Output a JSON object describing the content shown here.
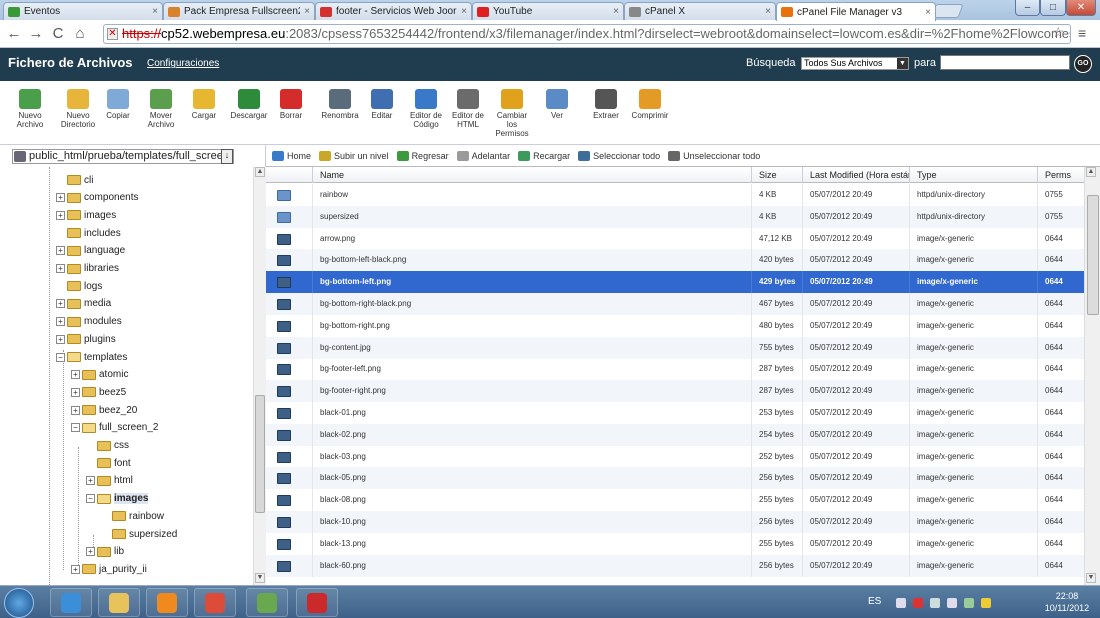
{
  "browser": {
    "tabs": [
      {
        "label": "Eventos",
        "icon": "green-calendar-icon",
        "color": "#3a9a3a"
      },
      {
        "label": "Pack Empresa Fullscreen2",
        "icon": "joomla-icon",
        "color": "#d9822b"
      },
      {
        "label": "footer - Servicios Web Joor",
        "icon": "w-icon",
        "color": "#d43030"
      },
      {
        "label": "YouTube",
        "icon": "youtube-icon",
        "color": "#e02020"
      },
      {
        "label": "cPanel X",
        "icon": "loading-icon",
        "color": "#888888"
      },
      {
        "label": "cPanel File Manager v3",
        "icon": "cpanel-icon",
        "color": "#e8730c"
      }
    ],
    "close_glyph": "×",
    "url": {
      "scheme": "https://",
      "host": "cp52.webempresa.eu",
      "rest": ":2083/cpsess7653254442/frontend/x3/filemanager/index.html?dirselect=webroot&domainselect=lowcom.es&dir=%2Fhome%2Flowcomes%2Fpub"
    },
    "nav": {
      "back": "←",
      "forward": "→",
      "reload": "C",
      "home": "⌂"
    },
    "star": "☆",
    "menu": "≡",
    "window_buttons": [
      "–",
      "□",
      "✕"
    ]
  },
  "header": {
    "title": "Fichero de Archivos",
    "config_link": "Configuraciones",
    "search_label": "Búsqueda",
    "search_scope": "Todos Sus Archivos",
    "search_for": "para",
    "search_value": "",
    "go": "GO"
  },
  "icon_toolbar": [
    {
      "label": "Nuevo\nArchivo",
      "icon": "new-file-icon",
      "color": "#4aa04a"
    },
    {
      "label": "Nuevo\nDirectorio",
      "icon": "new-folder-icon",
      "color": "#e6b53a"
    },
    {
      "label": "Copiar",
      "icon": "copy-icon",
      "color": "#7fa9d6"
    },
    {
      "label": "Mover\nArchivo",
      "icon": "move-file-icon",
      "color": "#5b9e4d"
    },
    {
      "label": "Cargar",
      "icon": "upload-icon",
      "color": "#e8b732"
    },
    {
      "label": "Descargar",
      "icon": "download-icon",
      "color": "#2e8b3c"
    },
    {
      "label": "Borrar",
      "icon": "delete-icon",
      "color": "#d42b2b"
    },
    {
      "label": "Renombra",
      "icon": "rename-icon",
      "color": "#5a6b7b"
    },
    {
      "label": "Editar",
      "icon": "edit-icon",
      "color": "#3f6fb0"
    },
    {
      "label": "Editor de\nCódigo",
      "icon": "code-editor-icon",
      "color": "#3a79c7"
    },
    {
      "label": "Editor de\nHTML",
      "icon": "html-editor-icon",
      "color": "#6b6b6b"
    },
    {
      "label": "Cambiar\nlos\nPermisos",
      "icon": "key-icon",
      "color": "#e0a21b"
    },
    {
      "label": "Ver",
      "icon": "view-icon",
      "color": "#5a8bc7"
    },
    {
      "label": "Extraer",
      "icon": "extract-icon",
      "color": "#555555"
    },
    {
      "label": "Comprimir",
      "icon": "compress-icon",
      "color": "#e39b25"
    }
  ],
  "sidebar": {
    "path": "public_html/prueba/templates/full_scree",
    "path_button": "↓",
    "tree": [
      {
        "label": "cli",
        "depth": 0,
        "expander": "",
        "open": false,
        "selected": false
      },
      {
        "label": "components",
        "depth": 0,
        "expander": "+",
        "open": false,
        "selected": false
      },
      {
        "label": "images",
        "depth": 0,
        "expander": "+",
        "open": false,
        "selected": false
      },
      {
        "label": "includes",
        "depth": 0,
        "expander": "",
        "open": false,
        "selected": false
      },
      {
        "label": "language",
        "depth": 0,
        "expander": "+",
        "open": false,
        "selected": false
      },
      {
        "label": "libraries",
        "depth": 0,
        "expander": "+",
        "open": false,
        "selected": false
      },
      {
        "label": "logs",
        "depth": 0,
        "expander": "",
        "open": false,
        "selected": false
      },
      {
        "label": "media",
        "depth": 0,
        "expander": "+",
        "open": false,
        "selected": false
      },
      {
        "label": "modules",
        "depth": 0,
        "expander": "+",
        "open": false,
        "selected": false
      },
      {
        "label": "plugins",
        "depth": 0,
        "expander": "+",
        "open": false,
        "selected": false
      },
      {
        "label": "templates",
        "depth": 0,
        "expander": "−",
        "open": true,
        "selected": false
      },
      {
        "label": "atomic",
        "depth": 1,
        "expander": "+",
        "open": false,
        "selected": false
      },
      {
        "label": "beez5",
        "depth": 1,
        "expander": "+",
        "open": false,
        "selected": false
      },
      {
        "label": "beez_20",
        "depth": 1,
        "expander": "+",
        "open": false,
        "selected": false
      },
      {
        "label": "full_screen_2",
        "depth": 1,
        "expander": "−",
        "open": true,
        "selected": false
      },
      {
        "label": "css",
        "depth": 2,
        "expander": "",
        "open": false,
        "selected": false
      },
      {
        "label": "font",
        "depth": 2,
        "expander": "",
        "open": false,
        "selected": false
      },
      {
        "label": "html",
        "depth": 2,
        "expander": "+",
        "open": false,
        "selected": false
      },
      {
        "label": "images",
        "depth": 2,
        "expander": "−",
        "open": true,
        "selected": true
      },
      {
        "label": "rainbow",
        "depth": 3,
        "expander": "",
        "open": false,
        "selected": false
      },
      {
        "label": "supersized",
        "depth": 3,
        "expander": "",
        "open": false,
        "selected": false
      },
      {
        "label": "lib",
        "depth": 2,
        "expander": "+",
        "open": false,
        "selected": false
      },
      {
        "label": "ja_purity_ii",
        "depth": 1,
        "expander": "+",
        "open": false,
        "selected": false
      }
    ]
  },
  "file_nav": [
    {
      "label": "Home",
      "icon": "home-icon",
      "color": "#3a7bc8"
    },
    {
      "label": "Subir un nivel",
      "icon": "up-level-icon",
      "color": "#c8a82a"
    },
    {
      "label": "Regresar",
      "icon": "back-arrow-icon",
      "color": "#3c9a3c"
    },
    {
      "label": "Adelantar",
      "icon": "forward-arrow-icon",
      "color": "#9a9a9a"
    },
    {
      "label": "Recargar",
      "icon": "reload-icon",
      "color": "#3c9a5c"
    },
    {
      "label": "Seleccionar todo",
      "icon": "select-all-icon",
      "color": "#3c6e9a"
    },
    {
      "label": "Unseleccionar todo",
      "icon": "unselect-all-icon",
      "color": "#666666"
    }
  ],
  "table": {
    "columns": [
      "Name",
      "Size",
      "Last Modified (Hora están",
      "Type",
      "Perms"
    ],
    "rows": [
      {
        "name": "rainbow",
        "size": "4 KB",
        "modified": "05/07/2012 20:49",
        "type": "httpd/unix-directory",
        "perms": "0755",
        "kind": "dir",
        "selected": false
      },
      {
        "name": "supersized",
        "size": "4 KB",
        "modified": "05/07/2012 20:49",
        "type": "httpd/unix-directory",
        "perms": "0755",
        "kind": "dir",
        "selected": false
      },
      {
        "name": "arrow.png",
        "size": "47,12 KB",
        "modified": "05/07/2012 20:49",
        "type": "image/x-generic",
        "perms": "0644",
        "kind": "file",
        "selected": false
      },
      {
        "name": "bg-bottom-left-black.png",
        "size": "420 bytes",
        "modified": "05/07/2012 20:49",
        "type": "image/x-generic",
        "perms": "0644",
        "kind": "file",
        "selected": false
      },
      {
        "name": "bg-bottom-left.png",
        "size": "429 bytes",
        "modified": "05/07/2012 20:49",
        "type": "image/x-generic",
        "perms": "0644",
        "kind": "file",
        "selected": true
      },
      {
        "name": "bg-bottom-right-black.png",
        "size": "467 bytes",
        "modified": "05/07/2012 20:49",
        "type": "image/x-generic",
        "perms": "0644",
        "kind": "file",
        "selected": false
      },
      {
        "name": "bg-bottom-right.png",
        "size": "480 bytes",
        "modified": "05/07/2012 20:49",
        "type": "image/x-generic",
        "perms": "0644",
        "kind": "file",
        "selected": false
      },
      {
        "name": "bg-content.jpg",
        "size": "755 bytes",
        "modified": "05/07/2012 20:49",
        "type": "image/x-generic",
        "perms": "0644",
        "kind": "file",
        "selected": false
      },
      {
        "name": "bg-footer-left.png",
        "size": "287 bytes",
        "modified": "05/07/2012 20:49",
        "type": "image/x-generic",
        "perms": "0644",
        "kind": "file",
        "selected": false
      },
      {
        "name": "bg-footer-right.png",
        "size": "287 bytes",
        "modified": "05/07/2012 20:49",
        "type": "image/x-generic",
        "perms": "0644",
        "kind": "file",
        "selected": false
      },
      {
        "name": "black-01.png",
        "size": "253 bytes",
        "modified": "05/07/2012 20:49",
        "type": "image/x-generic",
        "perms": "0644",
        "kind": "file",
        "selected": false
      },
      {
        "name": "black-02.png",
        "size": "254 bytes",
        "modified": "05/07/2012 20:49",
        "type": "image/x-generic",
        "perms": "0644",
        "kind": "file",
        "selected": false
      },
      {
        "name": "black-03.png",
        "size": "252 bytes",
        "modified": "05/07/2012 20:49",
        "type": "image/x-generic",
        "perms": "0644",
        "kind": "file",
        "selected": false
      },
      {
        "name": "black-05.png",
        "size": "256 bytes",
        "modified": "05/07/2012 20:49",
        "type": "image/x-generic",
        "perms": "0644",
        "kind": "file",
        "selected": false
      },
      {
        "name": "black-08.png",
        "size": "255 bytes",
        "modified": "05/07/2012 20:49",
        "type": "image/x-generic",
        "perms": "0644",
        "kind": "file",
        "selected": false
      },
      {
        "name": "black-10.png",
        "size": "256 bytes",
        "modified": "05/07/2012 20:49",
        "type": "image/x-generic",
        "perms": "0644",
        "kind": "file",
        "selected": false
      },
      {
        "name": "black-13.png",
        "size": "255 bytes",
        "modified": "05/07/2012 20:49",
        "type": "image/x-generic",
        "perms": "0644",
        "kind": "file",
        "selected": false
      },
      {
        "name": "black-60.png",
        "size": "256 bytes",
        "modified": "05/07/2012 20:49",
        "type": "image/x-generic",
        "perms": "0644",
        "kind": "file",
        "selected": false
      }
    ]
  },
  "taskbar": {
    "apps": [
      {
        "icon": "internet-explorer-icon",
        "color": "#3a8fd8"
      },
      {
        "icon": "file-explorer-icon",
        "color": "#e8c25a"
      },
      {
        "icon": "media-player-icon",
        "color": "#f08a1e"
      },
      {
        "icon": "chrome-icon",
        "color": "#dd4b39"
      },
      {
        "icon": "network-people-icon",
        "color": "#6aa84f"
      },
      {
        "icon": "pdf-icon",
        "color": "#cc2a2a"
      }
    ],
    "lang": "ES",
    "time": "22:08",
    "date": "10/11/2012"
  }
}
